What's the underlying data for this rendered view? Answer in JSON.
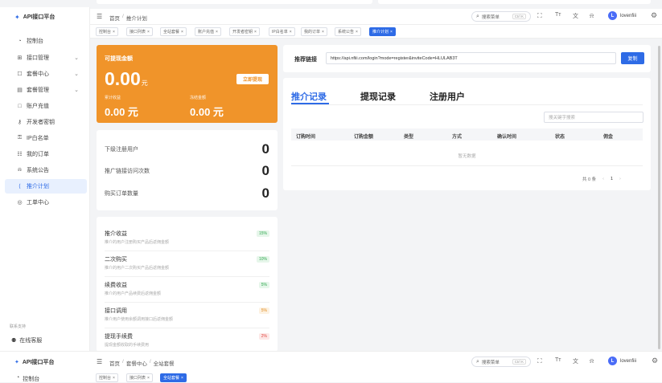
{
  "brand": {
    "name": "API接口平台"
  },
  "sidebar": {
    "items": [
      {
        "icon": "gauge-icon",
        "label": "控制台"
      },
      {
        "icon": "api-icon",
        "label": "接口管理",
        "expandable": true
      },
      {
        "icon": "cart-icon",
        "label": "套餐中心",
        "expandable": true
      },
      {
        "icon": "package-icon",
        "label": "套餐管理",
        "expandable": true
      },
      {
        "icon": "folder-icon",
        "label": "账户充值"
      },
      {
        "icon": "key-icon",
        "label": "开发者密钥"
      },
      {
        "icon": "lock-icon",
        "label": "IP白名单"
      },
      {
        "icon": "order-icon",
        "label": "我的订单"
      },
      {
        "icon": "bell-icon",
        "label": "系统公告"
      },
      {
        "icon": "share-icon",
        "label": "推介计划",
        "active": true
      },
      {
        "icon": "ticket-icon",
        "label": "工单中心"
      }
    ],
    "support_title": "联系支持",
    "support_link": "在线客服"
  },
  "header": {
    "breadcrumb_root": "首页",
    "breadcrumb_sep": "/",
    "breadcrumb_current": "推介计划",
    "search_label": "搜索菜单",
    "search_shortcut": "Ctrl K",
    "username": "lovenfiii",
    "avatar_letter": "L"
  },
  "tabs": [
    {
      "label": "控制台"
    },
    {
      "label": "接口列表"
    },
    {
      "label": "全站套餐"
    },
    {
      "label": "账户充值"
    },
    {
      "label": "开发者密钥"
    },
    {
      "label": "IP白名单"
    },
    {
      "label": "我的订单"
    },
    {
      "label": "系统公告"
    },
    {
      "label": "推介计划",
      "active": true
    }
  ],
  "balance": {
    "title": "可提现金额",
    "amount": "0.00",
    "unit": "元",
    "withdraw_button": "立即提现",
    "total_label": "累计收益",
    "total_value": "0.00 元",
    "withdrawn_label": "冻结金额",
    "withdrawn_value": "0.00 元"
  },
  "stats": [
    {
      "label": "下级注册用户",
      "value": "0"
    },
    {
      "label": "推广链接访问次数",
      "value": "0"
    },
    {
      "label": "购买订单数量",
      "value": "0"
    }
  ],
  "income": [
    {
      "title": "推介收益",
      "desc": "推介的用户注册购买产品后返佣金额",
      "rate": "15%",
      "color": "#2fa84f",
      "bg": "#e6f6ea"
    },
    {
      "title": "二次购买",
      "desc": "推介的用户二次购买产品后返佣金额",
      "rate": "10%",
      "color": "#2fa84f",
      "bg": "#e6f6ea"
    },
    {
      "title": "续费收益",
      "desc": "推介的用户产品续费后返佣金额",
      "rate": "5%",
      "color": "#2fa84f",
      "bg": "#e6f6ea"
    },
    {
      "title": "接口调用",
      "desc": "推介用户使用余额调用接口后返佣金额",
      "rate": "5%",
      "color": "#e08a1e",
      "bg": "#fdf2e2"
    },
    {
      "title": "提现手续费",
      "desc": "提现金额收取的手续费用",
      "rate": "2%",
      "color": "#e0443e",
      "bg": "#fde8e7"
    }
  ],
  "referral": {
    "label": "推荐链接",
    "url": "https://api.nfiii.com/login?mode=register&inviteCode=HLULAB3T",
    "copy_button": "复制"
  },
  "records": {
    "tabs": [
      "推介记录",
      "提现记录",
      "注册用户"
    ],
    "search_placeholder": "搜关键字搜索",
    "columns": [
      "订购时间",
      "订购金额",
      "类型",
      "方式",
      "确认时间",
      "状态",
      "佣金"
    ],
    "empty_text": "暂无数据",
    "total_text": "共 0 条",
    "page": "1"
  },
  "bottom": {
    "brand": "API接口平台",
    "breadcrumb_root": "首页",
    "breadcrumb_mid": "套餐中心",
    "breadcrumb_current": "全站套餐",
    "search_label": "搜索菜单",
    "search_shortcut": "Ctrl K",
    "username": "lovenfiii",
    "avatar_letter": "L",
    "first_nav": "控制台",
    "tabs": [
      "控制台",
      "接口列表",
      "全站套餐"
    ]
  }
}
